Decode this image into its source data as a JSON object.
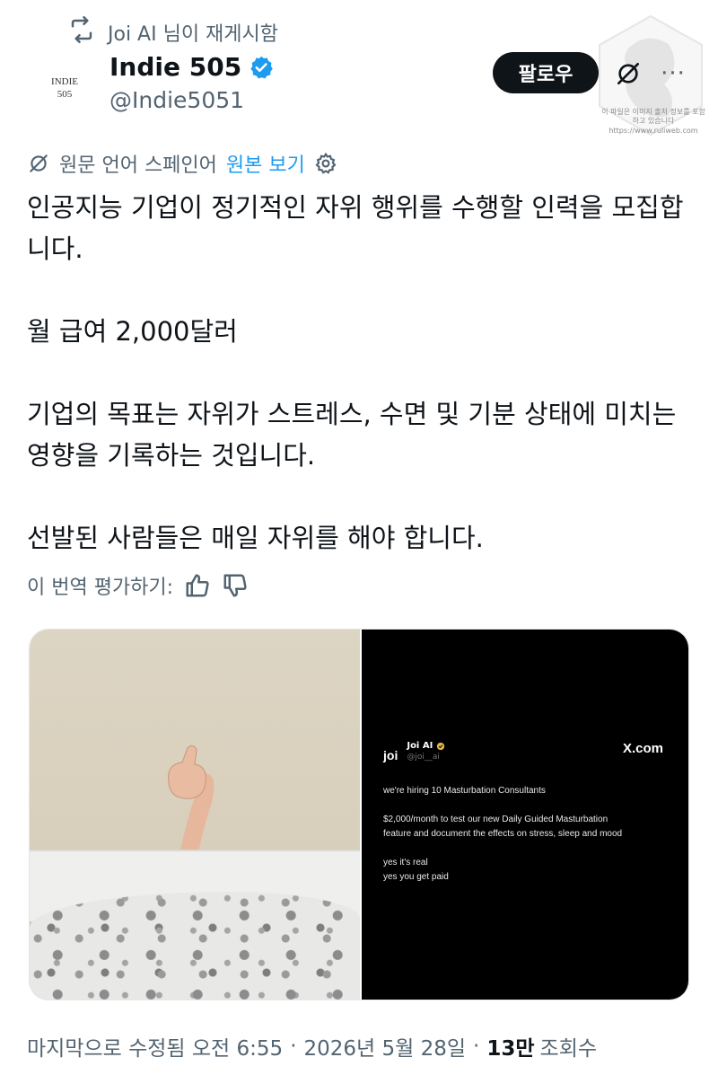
{
  "repost": {
    "icon": "repost-icon",
    "text": "Joi AI 님이 재게시함"
  },
  "author": {
    "avatar_lines": [
      "INDIE",
      "505"
    ],
    "name": "Indie 505",
    "handle": "@Indie5051",
    "verified": true
  },
  "actions": {
    "follow_label": "팔로우",
    "grok_icon": "grok-icon",
    "more_label": "···"
  },
  "watermark": {
    "lines": [
      "이 파일은 이미지 출처 정보를 포함하고 있습니다",
      "https://www.ruliweb.com"
    ]
  },
  "translation": {
    "source_label": "원문 언어 스페인어",
    "show_original": "원본 보기",
    "settings_icon": "gear-icon"
  },
  "tweet": {
    "paragraphs": [
      "인공지능 기업이 정기적인 자위 행위를 수행할 인력을 모집합니다.",
      "월 급여 2,000달러",
      "기업의 목표는 자위가 스트레스, 수면 및 기분 상태에 미치는 영향을 기록하는 것입니다.",
      "선발된 사람들은 매일 자위를 해야 합니다."
    ]
  },
  "rate": {
    "label": "이 번역 평가하기:",
    "up_icon": "thumbs-up-icon",
    "down_icon": "thumbs-down-icon"
  },
  "media": {
    "card": {
      "logo": "joi",
      "name": "Joi AI",
      "handle": "@joi__ai",
      "brand": "X.com",
      "lines": [
        "we're hiring 10 Masturbation Consultants",
        "",
        "$2,000/month to test our new Daily Guided Masturbation",
        "feature and document the effects on stress, sleep and mood",
        "",
        "yes it's real",
        "yes you get paid"
      ]
    }
  },
  "footer": {
    "edited": "마지막으로 수정됨 오전 6:55",
    "date": "2026년 5월 28일",
    "views_count": "13만",
    "views_label": "조회수"
  },
  "colors": {
    "link": "#1d9bf0",
    "muted": "#536471",
    "text": "#0f1419",
    "verified": "#1d9bf0"
  }
}
